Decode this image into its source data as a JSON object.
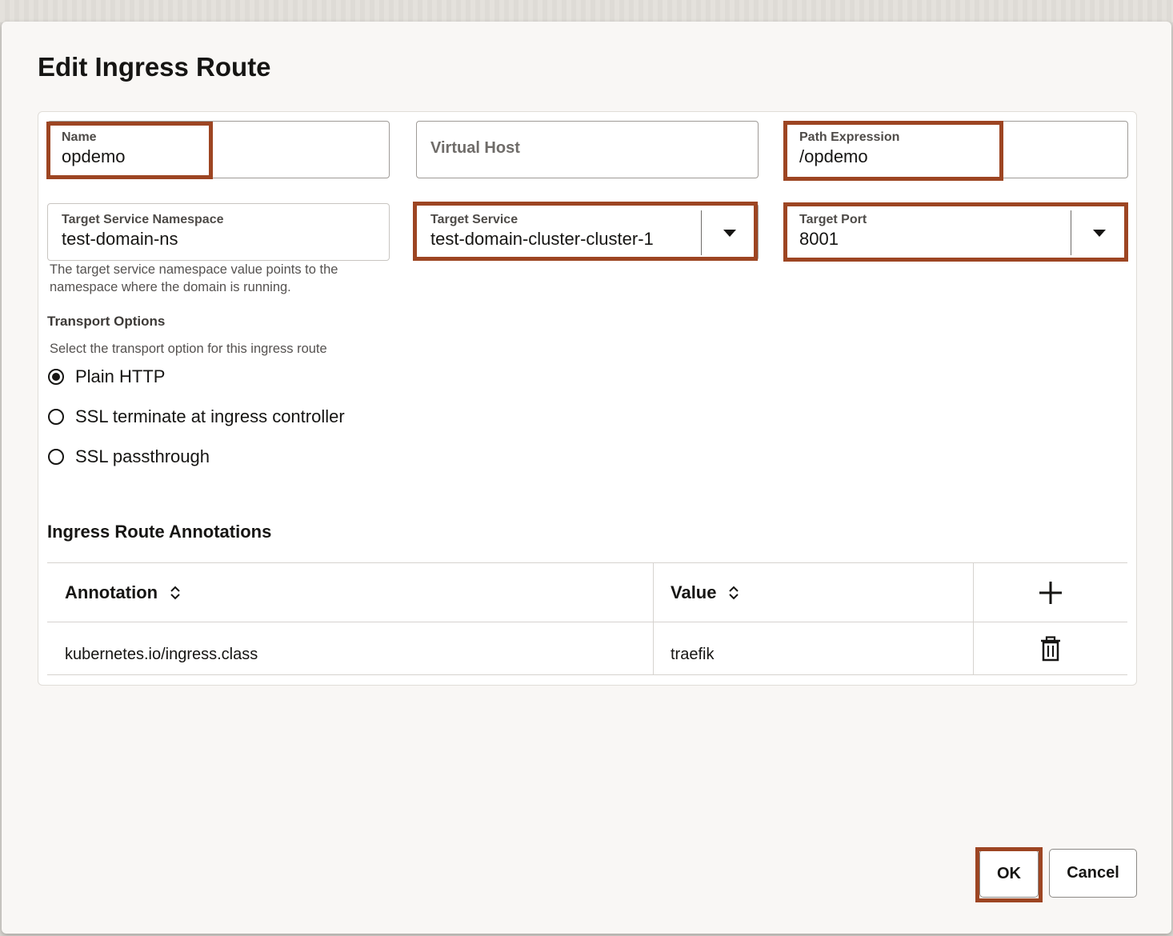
{
  "dialog": {
    "title": "Edit Ingress Route"
  },
  "fields": {
    "name": {
      "label": "Name",
      "value": "opdemo"
    },
    "virtual_host": {
      "placeholder": "Virtual Host"
    },
    "path_expression": {
      "label": "Path Expression",
      "value": "/opdemo"
    },
    "target_namespace": {
      "label": "Target Service Namespace",
      "value": "test-domain-ns",
      "help_line1": "The target service namespace value points to the",
      "help_line2": "namespace where the domain is running."
    },
    "target_service": {
      "label": "Target Service",
      "value": "test-domain-cluster-cluster-1"
    },
    "target_port": {
      "label": "Target Port",
      "value": "8001"
    }
  },
  "transport": {
    "label": "Transport Options",
    "help": "Select the transport option for this ingress route",
    "options": [
      {
        "label": "Plain HTTP",
        "selected": true
      },
      {
        "label": "SSL terminate at ingress controller",
        "selected": false
      },
      {
        "label": "SSL passthrough",
        "selected": false
      }
    ]
  },
  "annotations": {
    "heading": "Ingress Route Annotations",
    "columns": [
      "Annotation",
      "Value"
    ],
    "rows": [
      {
        "annotation": "kubernetes.io/ingress.class",
        "value": "traefik"
      }
    ]
  },
  "buttons": {
    "ok": "OK",
    "cancel": "Cancel"
  },
  "colors": {
    "highlight": "#9d4522",
    "accent": "#161513"
  }
}
